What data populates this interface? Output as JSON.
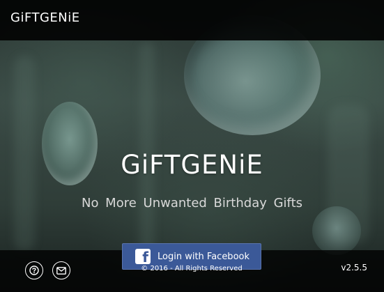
{
  "header": {
    "app_title": "GiFTGENiE"
  },
  "hero": {
    "title": "GiFTGENiE",
    "tagline": "No More Unwanted  Birthday  Gifts"
  },
  "login": {
    "facebook_label": "Login with Facebook",
    "facebook_icon_glyph": "f"
  },
  "footer": {
    "copyright": "© 2016 - All Rights Reserved",
    "version": "v2.5.5",
    "help_icon": "question-circle-icon",
    "mail_icon": "envelope-icon"
  },
  "colors": {
    "facebook_blue": "#3b5998",
    "bar_black": "#000000",
    "text_white": "#ffffff"
  }
}
